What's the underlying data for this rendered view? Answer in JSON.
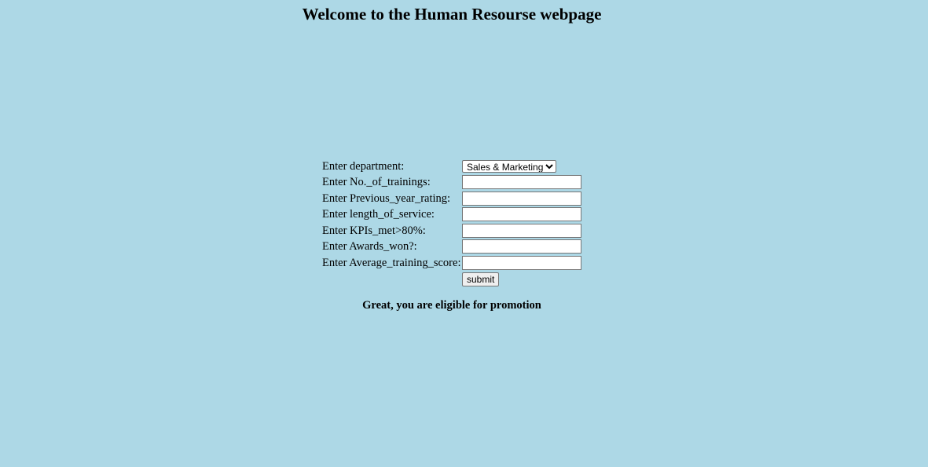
{
  "page": {
    "title": "Welcome to the Human Resourse webpage",
    "background_color": "#add8e6"
  },
  "form": {
    "fields": [
      {
        "label": "Enter department:",
        "type": "select",
        "value": "Sales & Marketing"
      },
      {
        "label": "Enter No._of_trainings:",
        "type": "text",
        "value": ""
      },
      {
        "label": "Enter Previous_year_rating:",
        "type": "text",
        "value": ""
      },
      {
        "label": "Enter length_of_service:",
        "type": "text",
        "value": ""
      },
      {
        "label": "Enter KPIs_met>80%:",
        "type": "text",
        "value": ""
      },
      {
        "label": "Enter Awards_won?:",
        "type": "text",
        "value": ""
      },
      {
        "label": "Enter Average_training_score:",
        "type": "text",
        "value": ""
      }
    ],
    "submit_label": "submit"
  },
  "result": {
    "message": "Great, you are eligible for promotion"
  }
}
